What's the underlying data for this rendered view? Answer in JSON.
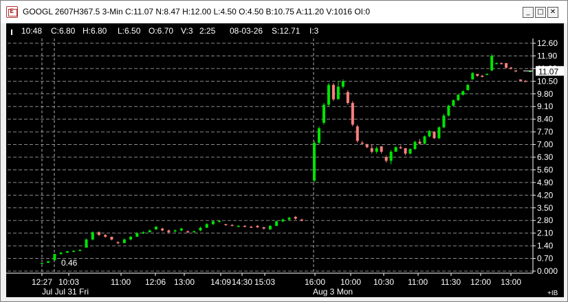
{
  "window": {
    "title": "GOOGL 2607H367.5 3-Min C:11.07 N:8.47 H:12.00 L:4.50 O:4.50 B:10.75 A:11.20 V:1016 OI:0",
    "minimize": "_",
    "maximize": "□",
    "close": "✕"
  },
  "infobar": {
    "time": "10:48",
    "close": "C:6.80",
    "high": "H:6.80",
    "low": "L:6.50",
    "open": "O:6.70",
    "volume": "V:3",
    "bar_time": "2:25",
    "date": "08-03-26",
    "underlying": "S:12.71",
    "count": "I:3"
  },
  "price_axis": {
    "labels": [
      "12.60",
      "11.90",
      "11.20",
      "10.50",
      "9.80",
      "9.10",
      "8.40",
      "7.70",
      "7.00",
      "6.30",
      "5.60",
      "4.90",
      "4.20",
      "3.50",
      "2.80",
      "2.10",
      "1.40",
      "0.70",
      "0.000"
    ],
    "current_price": "11.07"
  },
  "time_axis": {
    "top": [
      "12:27",
      "10:03",
      "11:00",
      "12:06",
      "13:00",
      "14:09",
      "14:30",
      "15:03",
      "16:00",
      "10:00",
      "10:30",
      "11:00",
      "11:30",
      "12:00",
      "13:00"
    ],
    "day_left": "Jul Jul 31 Fri",
    "day_right": "Aug 3 Mon",
    "corner": "+IB"
  },
  "annotation": {
    "low_label": "0.46"
  },
  "colors": {
    "up": "#00e600",
    "down": "#ff8080",
    "grid": "#8a8a8a",
    "bg": "#000000"
  },
  "chart_data": {
    "type": "candlestick",
    "title": "GOOGL 2607H367.5 3-Min",
    "ylim": [
      0.0,
      12.6
    ],
    "candles": [
      {
        "o": 0.46,
        "h": 0.46,
        "l": 0.46,
        "c": 0.46
      },
      {
        "o": 0.46,
        "h": 0.55,
        "l": 0.46,
        "c": 0.55
      },
      {
        "o": 0.6,
        "h": 0.95,
        "l": 0.6,
        "c": 0.95
      },
      {
        "o": 0.95,
        "h": 1.05,
        "l": 0.9,
        "c": 1.02
      },
      {
        "o": 1.02,
        "h": 1.12,
        "l": 1.0,
        "c": 1.1
      },
      {
        "o": 1.1,
        "h": 1.15,
        "l": 1.05,
        "c": 1.12
      },
      {
        "o": 1.12,
        "h": 1.2,
        "l": 1.1,
        "c": 1.18
      },
      {
        "o": 1.3,
        "h": 1.8,
        "l": 1.3,
        "c": 1.75
      },
      {
        "o": 1.75,
        "h": 2.2,
        "l": 1.7,
        "c": 2.15
      },
      {
        "o": 2.15,
        "h": 2.2,
        "l": 1.95,
        "c": 2.0
      },
      {
        "o": 2.0,
        "h": 2.05,
        "l": 1.85,
        "c": 1.9
      },
      {
        "o": 1.9,
        "h": 1.9,
        "l": 1.7,
        "c": 1.75
      },
      {
        "o": 1.6,
        "h": 1.65,
        "l": 1.5,
        "c": 1.55
      },
      {
        "o": 1.55,
        "h": 1.8,
        "l": 1.55,
        "c": 1.75
      },
      {
        "o": 1.75,
        "h": 1.95,
        "l": 1.7,
        "c": 1.9
      },
      {
        "o": 1.9,
        "h": 2.15,
        "l": 1.9,
        "c": 2.1
      },
      {
        "o": 2.1,
        "h": 2.2,
        "l": 2.05,
        "c": 2.15
      },
      {
        "o": 2.15,
        "h": 2.3,
        "l": 2.15,
        "c": 2.25
      },
      {
        "o": 2.3,
        "h": 2.5,
        "l": 2.3,
        "c": 2.45
      },
      {
        "o": 2.35,
        "h": 2.4,
        "l": 2.2,
        "c": 2.25
      },
      {
        "o": 2.25,
        "h": 2.3,
        "l": 2.1,
        "c": 2.15
      },
      {
        "o": 2.2,
        "h": 2.3,
        "l": 2.15,
        "c": 2.25
      },
      {
        "o": 2.25,
        "h": 2.4,
        "l": 2.2,
        "c": 2.35
      },
      {
        "o": 2.2,
        "h": 2.25,
        "l": 2.1,
        "c": 2.15
      },
      {
        "o": 2.15,
        "h": 2.25,
        "l": 2.15,
        "c": 2.2
      },
      {
        "o": 2.25,
        "h": 2.45,
        "l": 2.2,
        "c": 2.4
      },
      {
        "o": 2.4,
        "h": 2.65,
        "l": 2.4,
        "c": 2.6
      },
      {
        "o": 2.6,
        "h": 2.8,
        "l": 2.55,
        "c": 2.75
      },
      {
        "o": 2.75,
        "h": 2.8,
        "l": 2.7,
        "c": 2.78
      },
      {
        "o": 2.6,
        "h": 2.6,
        "l": 2.5,
        "c": 2.55
      },
      {
        "o": 2.55,
        "h": 2.6,
        "l": 2.5,
        "c": 2.52
      },
      {
        "o": 2.5,
        "h": 2.55,
        "l": 2.45,
        "c": 2.5
      },
      {
        "o": 2.5,
        "h": 2.55,
        "l": 2.45,
        "c": 2.48
      },
      {
        "o": 2.45,
        "h": 2.5,
        "l": 2.4,
        "c": 2.42
      },
      {
        "o": 2.5,
        "h": 2.55,
        "l": 2.4,
        "c": 2.42
      },
      {
        "o": 2.42,
        "h": 2.45,
        "l": 2.3,
        "c": 2.35
      },
      {
        "o": 2.3,
        "h": 2.55,
        "l": 2.3,
        "c": 2.5
      },
      {
        "o": 2.5,
        "h": 2.8,
        "l": 2.5,
        "c": 2.75
      },
      {
        "o": 2.75,
        "h": 2.9,
        "l": 2.7,
        "c": 2.85
      },
      {
        "o": 2.85,
        "h": 3.0,
        "l": 2.8,
        "c": 2.95
      },
      {
        "o": 3.0,
        "h": 3.05,
        "l": 2.85,
        "c": 2.9
      },
      {
        "o": 2.85,
        "h": 2.9,
        "l": 2.75,
        "c": 2.8
      },
      {
        "o": 5.0,
        "h": 7.2,
        "l": 4.9,
        "c": 7.1
      },
      {
        "o": 7.1,
        "h": 8.0,
        "l": 7.0,
        "c": 7.9
      },
      {
        "o": 8.2,
        "h": 9.3,
        "l": 8.1,
        "c": 9.2
      },
      {
        "o": 9.2,
        "h": 10.4,
        "l": 9.1,
        "c": 10.3
      },
      {
        "o": 10.3,
        "h": 10.4,
        "l": 9.4,
        "c": 9.5
      },
      {
        "o": 9.5,
        "h": 10.5,
        "l": 9.5,
        "c": 10.2
      },
      {
        "o": 10.2,
        "h": 10.6,
        "l": 10.1,
        "c": 10.5
      },
      {
        "o": 9.9,
        "h": 10.0,
        "l": 9.2,
        "c": 9.3
      },
      {
        "o": 9.3,
        "h": 9.4,
        "l": 8.0,
        "c": 8.1
      },
      {
        "o": 8.0,
        "h": 8.1,
        "l": 7.1,
        "c": 7.2
      },
      {
        "o": 7.1,
        "h": 7.2,
        "l": 7.0,
        "c": 7.05
      },
      {
        "o": 7.0,
        "h": 7.05,
        "l": 6.8,
        "c": 6.85
      },
      {
        "o": 6.8,
        "h": 7.0,
        "l": 6.5,
        "c": 6.6
      },
      {
        "o": 6.6,
        "h": 6.9,
        "l": 6.5,
        "c": 6.8
      },
      {
        "o": 6.9,
        "h": 6.9,
        "l": 6.5,
        "c": 6.6
      },
      {
        "o": 6.3,
        "h": 6.4,
        "l": 6.0,
        "c": 6.1
      },
      {
        "o": 6.1,
        "h": 6.7,
        "l": 5.9,
        "c": 6.6
      },
      {
        "o": 6.6,
        "h": 6.9,
        "l": 6.6,
        "c": 6.85
      },
      {
        "o": 6.85,
        "h": 6.95,
        "l": 6.75,
        "c": 6.8
      },
      {
        "o": 6.8,
        "h": 6.8,
        "l": 6.4,
        "c": 6.5
      },
      {
        "o": 6.5,
        "h": 6.8,
        "l": 6.45,
        "c": 6.75
      },
      {
        "o": 6.75,
        "h": 7.2,
        "l": 6.7,
        "c": 7.15
      },
      {
        "o": 7.15,
        "h": 7.3,
        "l": 7.0,
        "c": 7.05
      },
      {
        "o": 7.05,
        "h": 7.5,
        "l": 7.0,
        "c": 7.45
      },
      {
        "o": 7.45,
        "h": 7.8,
        "l": 7.4,
        "c": 7.75
      },
      {
        "o": 7.7,
        "h": 7.75,
        "l": 7.3,
        "c": 7.35
      },
      {
        "o": 7.35,
        "h": 8.0,
        "l": 7.3,
        "c": 7.95
      },
      {
        "o": 7.95,
        "h": 8.7,
        "l": 7.9,
        "c": 8.6
      },
      {
        "o": 8.6,
        "h": 9.2,
        "l": 8.55,
        "c": 9.15
      },
      {
        "o": 9.15,
        "h": 9.5,
        "l": 9.1,
        "c": 9.45
      },
      {
        "o": 9.45,
        "h": 9.8,
        "l": 9.4,
        "c": 9.75
      },
      {
        "o": 9.75,
        "h": 10.0,
        "l": 9.7,
        "c": 9.95
      },
      {
        "o": 10.0,
        "h": 10.35,
        "l": 10.0,
        "c": 10.3
      },
      {
        "o": 10.6,
        "h": 11.0,
        "l": 10.6,
        "c": 10.95
      },
      {
        "o": 10.9,
        "h": 10.9,
        "l": 10.75,
        "c": 10.8
      },
      {
        "o": 10.8,
        "h": 10.85,
        "l": 10.7,
        "c": 10.75
      },
      {
        "o": 10.9,
        "h": 10.95,
        "l": 10.85,
        "c": 10.9
      },
      {
        "o": 11.1,
        "h": 12.0,
        "l": 11.05,
        "c": 11.9
      },
      {
        "o": 11.5,
        "h": 11.55,
        "l": 11.45,
        "c": 11.5
      },
      {
        "o": 11.5,
        "h": 11.55,
        "l": 11.45,
        "c": 11.48
      },
      {
        "o": 11.5,
        "h": 11.5,
        "l": 11.2,
        "c": 11.25
      },
      {
        "o": 11.25,
        "h": 11.3,
        "l": 11.15,
        "c": 11.2
      },
      {
        "o": 11.1,
        "h": 11.1,
        "l": 11.0,
        "c": 11.05
      },
      {
        "o": 10.6,
        "h": 10.6,
        "l": 10.5,
        "c": 10.52
      },
      {
        "o": 10.52,
        "h": 10.55,
        "l": 10.45,
        "c": 10.5
      },
      {
        "o": 11.07,
        "h": 11.07,
        "l": 11.07,
        "c": 11.07
      }
    ]
  }
}
